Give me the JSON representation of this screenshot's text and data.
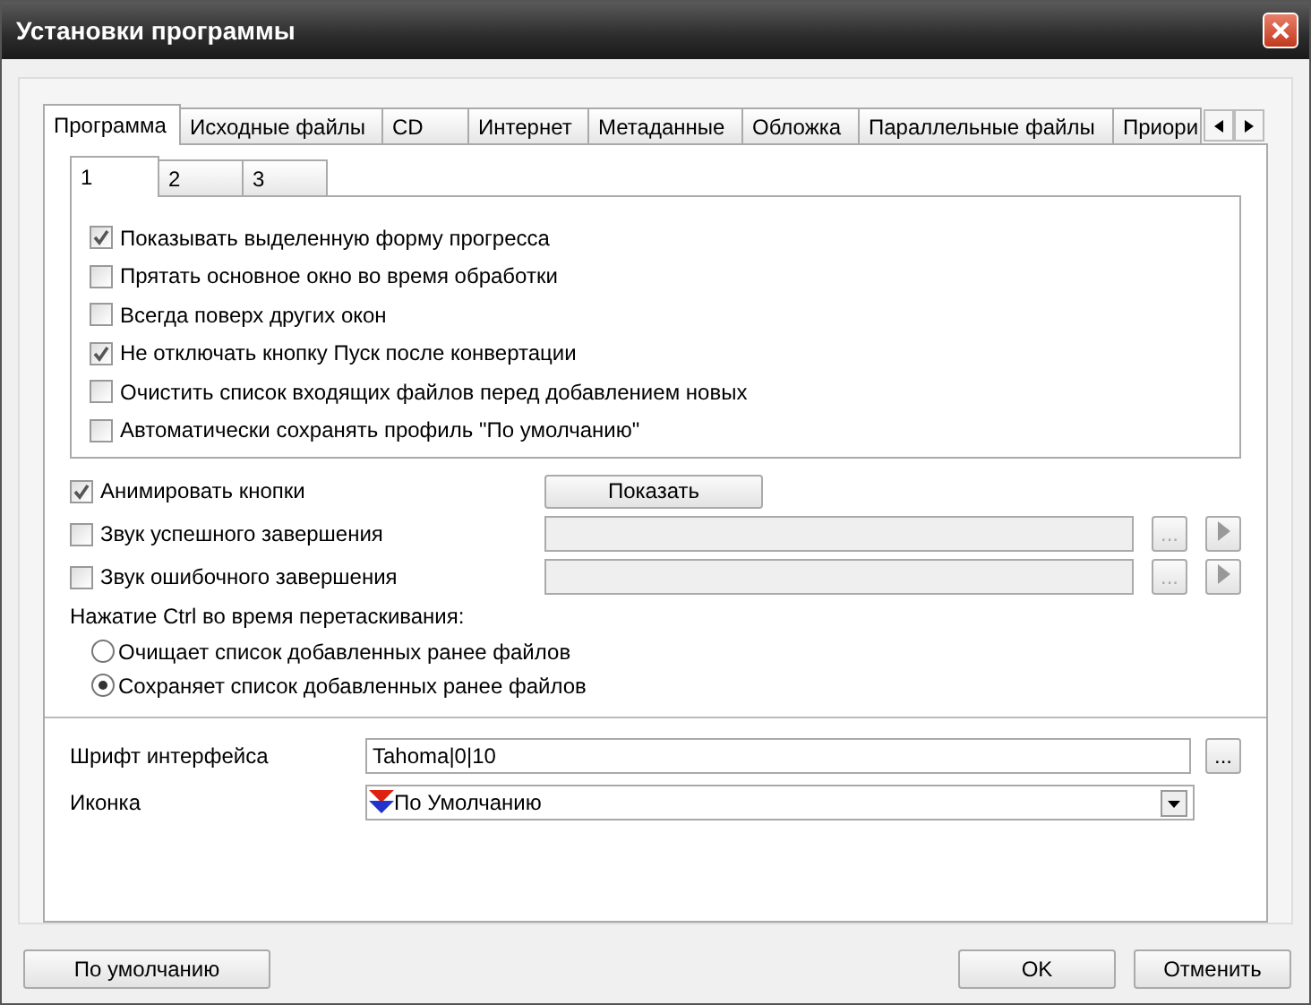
{
  "window": {
    "title": "Установки программы"
  },
  "tabs": [
    {
      "label": "Программа",
      "selected": true
    },
    {
      "label": "Исходные файлы",
      "selected": false
    },
    {
      "label": "CD",
      "selected": false
    },
    {
      "label": "Интернет",
      "selected": false
    },
    {
      "label": "Метаданные",
      "selected": false
    },
    {
      "label": "Обложка",
      "selected": false
    },
    {
      "label": "Параллельные файлы",
      "selected": false
    },
    {
      "label": "Приори",
      "selected": false
    }
  ],
  "subtabs": [
    {
      "label": "1",
      "selected": true
    },
    {
      "label": "2",
      "selected": false
    },
    {
      "label": "3",
      "selected": false
    }
  ],
  "options": [
    {
      "label": "Показывать выделенную форму прогресса",
      "checked": true
    },
    {
      "label": "Прятать основное окно во время обработки",
      "checked": false
    },
    {
      "label": "Всегда поверх других окон",
      "checked": false
    },
    {
      "label": "Не отключать кнопку Пуск после конвертации",
      "checked": true
    },
    {
      "label": "Очистить список входящих файлов перед добавлением новых",
      "checked": false
    },
    {
      "label": "Автоматически сохранять профиль \"По умолчанию\"",
      "checked": false
    }
  ],
  "animate": {
    "label": "Анимировать кнопки",
    "checked": true,
    "button": "Показать"
  },
  "sounds": [
    {
      "label": "Звук успешного завершения",
      "checked": false,
      "browse": "..."
    },
    {
      "label": "Звук ошибочного завершения",
      "checked": false,
      "browse": "..."
    }
  ],
  "ctrl": {
    "label": "Нажатие Ctrl во время перетаскивания:",
    "options": [
      {
        "label": "Очищает список добавленных ранее файлов",
        "selected": false
      },
      {
        "label": "Сохраняет список добавленных ранее файлов",
        "selected": true
      }
    ]
  },
  "font": {
    "label": "Шрифт интерфейса",
    "value": "Tahoma|0|10",
    "browse": "..."
  },
  "icon": {
    "label": "Иконка",
    "value": "По Умолчанию"
  },
  "buttons": {
    "default": "По умолчанию",
    "ok": "OK",
    "cancel": "Отменить"
  }
}
